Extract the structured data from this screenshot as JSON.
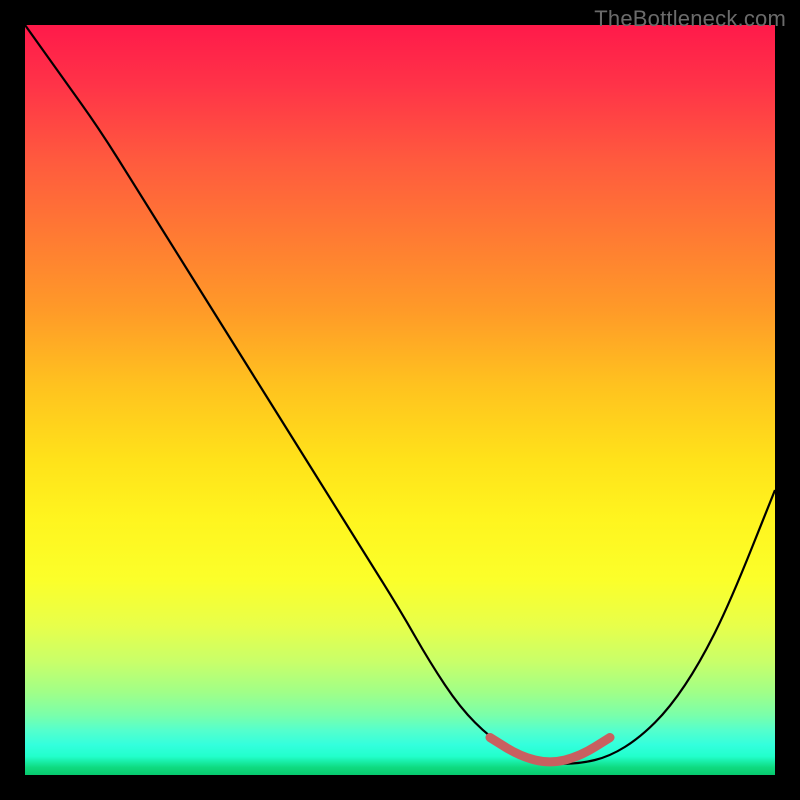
{
  "watermark": "TheBottleneck.com",
  "chart_data": {
    "type": "line",
    "title": "",
    "xlabel": "",
    "ylabel": "",
    "xlim": [
      0,
      100
    ],
    "ylim": [
      0,
      100
    ],
    "series": [
      {
        "name": "curve",
        "x": [
          0,
          5,
          10,
          15,
          20,
          25,
          30,
          35,
          40,
          45,
          50,
          54,
          58,
          62,
          66,
          70,
          74,
          78,
          82,
          86,
          90,
          94,
          100
        ],
        "y": [
          100,
          93,
          86,
          78,
          70,
          62,
          54,
          46,
          38,
          30,
          22,
          15,
          9,
          5,
          2.5,
          1.5,
          1.5,
          2.5,
          5,
          9,
          15,
          23,
          38
        ]
      },
      {
        "name": "highlight-segment",
        "x": [
          62,
          66,
          70,
          74,
          78
        ],
        "y": [
          5,
          2.5,
          1.5,
          2.5,
          5
        ]
      }
    ],
    "colors": {
      "curve": "#000000",
      "highlight": "#c86060"
    }
  }
}
